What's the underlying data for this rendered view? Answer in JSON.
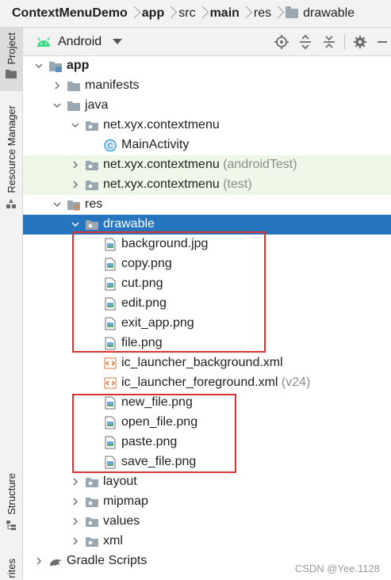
{
  "breadcrumb": {
    "items": [
      {
        "label": "ContextMenuDemo",
        "bold": true,
        "folder": false
      },
      {
        "label": "app",
        "bold": true,
        "folder": false
      },
      {
        "label": "src",
        "bold": false,
        "folder": false
      },
      {
        "label": "main",
        "bold": true,
        "folder": false
      },
      {
        "label": "res",
        "bold": false,
        "folder": false
      },
      {
        "label": "drawable",
        "bold": false,
        "folder": true
      }
    ]
  },
  "left_strip": {
    "project_label": "Project",
    "resource_manager_label": "Resource Manager",
    "structure_label": "Structure",
    "favorites_label": "rites"
  },
  "toolbar": {
    "view_name": "Android",
    "buttons": [
      "locate-icon",
      "expand-all-icon",
      "collapse-all-icon",
      "gear-icon",
      "minimize-icon"
    ]
  },
  "tree": {
    "rows": [
      {
        "label": "app",
        "hint": "",
        "icon": "module-folder-icon",
        "expanded": true
      },
      {
        "label": "manifests",
        "hint": "",
        "icon": "folder-icon",
        "expanded": false
      },
      {
        "label": "java",
        "hint": "",
        "icon": "folder-icon",
        "expanded": true
      },
      {
        "label": "net.xyx.contextmenu",
        "hint": "",
        "icon": "package-icon",
        "expanded": true
      },
      {
        "label": "MainActivity",
        "hint": "",
        "icon": "class-icon"
      },
      {
        "label": "net.xyx.contextmenu",
        "hint": "(androidTest)",
        "icon": "package-icon",
        "expanded": false
      },
      {
        "label": "net.xyx.contextmenu",
        "hint": "(test)",
        "icon": "package-icon",
        "expanded": false
      },
      {
        "label": "res",
        "hint": "",
        "icon": "res-folder-icon",
        "expanded": true
      },
      {
        "label": "drawable",
        "hint": "",
        "icon": "package-icon",
        "expanded": true
      },
      {
        "label": "background.jpg",
        "hint": "",
        "icon": "image-file-icon"
      },
      {
        "label": "copy.png",
        "hint": "",
        "icon": "image-file-icon"
      },
      {
        "label": "cut.png",
        "hint": "",
        "icon": "image-file-icon"
      },
      {
        "label": "edit.png",
        "hint": "",
        "icon": "image-file-icon"
      },
      {
        "label": "exit_app.png",
        "hint": "",
        "icon": "image-file-icon"
      },
      {
        "label": "file.png",
        "hint": "",
        "icon": "image-file-icon"
      },
      {
        "label": "ic_launcher_background.xml",
        "hint": "",
        "icon": "xml-file-icon"
      },
      {
        "label": "ic_launcher_foreground.xml",
        "hint": "(v24)",
        "icon": "xml-file-icon"
      },
      {
        "label": "new_file.png",
        "hint": "",
        "icon": "image-file-icon"
      },
      {
        "label": "open_file.png",
        "hint": "",
        "icon": "image-file-icon"
      },
      {
        "label": "paste.png",
        "hint": "",
        "icon": "image-file-icon"
      },
      {
        "label": "save_file.png",
        "hint": "",
        "icon": "image-file-icon"
      },
      {
        "label": "layout",
        "hint": "",
        "icon": "package-icon",
        "expanded": false
      },
      {
        "label": "mipmap",
        "hint": "",
        "icon": "package-icon",
        "expanded": false
      },
      {
        "label": "values",
        "hint": "",
        "icon": "package-icon",
        "expanded": false
      },
      {
        "label": "xml",
        "hint": "",
        "icon": "package-icon",
        "expanded": false
      },
      {
        "label": "Gradle Scripts",
        "hint": "",
        "icon": "gradle-icon",
        "expanded": false
      }
    ]
  },
  "watermark": "CSDN @Yee.1128",
  "colors": {
    "selection": "#2675bf",
    "test_background": "#eef7e8",
    "annotation_red": "#e03131",
    "folder": "#9aa7b0",
    "xml_orange": "#e07a3f",
    "android_green": "#3ddc84"
  }
}
